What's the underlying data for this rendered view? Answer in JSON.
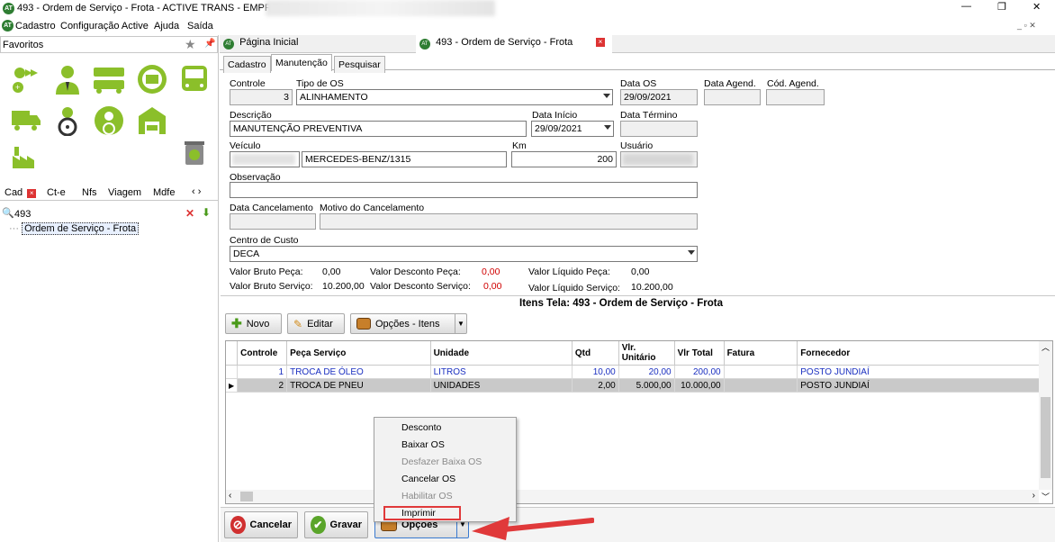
{
  "window": {
    "title": "493 - Ordem de Serviço - Frota - ACTIVE TRANS - EMPRESA: /",
    "controls": {
      "minimize": "—",
      "restore": "❐",
      "close": "✕"
    }
  },
  "menubar": {
    "items": [
      "Cadastro",
      "Configuração Active",
      "Ajuda",
      "Saída"
    ]
  },
  "sidebar": {
    "favorites_label": "Favoritos",
    "bottom_tabs": [
      "Cad",
      "Ct-e",
      "Nfs",
      "Viagem",
      "Mdfe"
    ],
    "search_value": "493",
    "tree_item": "Ordem de Serviço - Frota"
  },
  "doc_tabs": [
    "Página Inicial",
    "493 - Ordem de Serviço - Frota"
  ],
  "form_tabs": [
    "Cadastro",
    "Manutenção",
    "Pesquisar"
  ],
  "form": {
    "controle": {
      "label": "Controle",
      "value": "3"
    },
    "tipo_os": {
      "label": "Tipo de OS",
      "value": "ALINHAMENTO"
    },
    "data_os": {
      "label": "Data OS",
      "value": "29/09/2021"
    },
    "data_agend": {
      "label": "Data Agend.",
      "value": ""
    },
    "cod_agend": {
      "label": "Cód. Agend.",
      "value": ""
    },
    "descricao": {
      "label": "Descrição",
      "value": "MANUTENÇÃO PREVENTIVA"
    },
    "data_inicio": {
      "label": "Data Início",
      "value": "29/09/2021"
    },
    "data_termino": {
      "label": "Data Término",
      "value": ""
    },
    "veiculo": {
      "label": "Veículo",
      "plate": "",
      "model": "MERCEDES-BENZ/1315"
    },
    "km": {
      "label": "Km",
      "value": "200"
    },
    "usuario": {
      "label": "Usuário",
      "value": ""
    },
    "observacao": {
      "label": "Observação",
      "value": ""
    },
    "data_cancelamento": {
      "label": "Data Cancelamento",
      "value": ""
    },
    "motivo_cancelamento": {
      "label": "Motivo do Cancelamento",
      "value": ""
    },
    "centro_custo": {
      "label": "Centro de Custo",
      "value": "DECA"
    }
  },
  "totals": {
    "bruto_peca_label": "Valor Bruto Peça:",
    "bruto_peca": "0,00",
    "bruto_servico_label": "Valor Bruto Serviço:",
    "bruto_servico": "10.200,00",
    "desconto_peca_label": "Valor Desconto Peça:",
    "desconto_peca": "0,00",
    "desconto_servico_label": "Valor Desconto Serviço:",
    "desconto_servico": "0,00",
    "liquido_peca_label": "Valor Líquido Peça:",
    "liquido_peca": "0,00",
    "liquido_servico_label": "Valor Líquido Serviço:",
    "liquido_servico": "10.200,00"
  },
  "items_title": "Itens Tela:  493 - Ordem de Serviço - Frota",
  "item_buttons": {
    "novo": "Novo",
    "editar": "Editar",
    "opcoes": "Opções - Itens"
  },
  "grid": {
    "columns": [
      "Controle",
      "Peça Serviço",
      "Unidade",
      "Qtd",
      "Vlr. Unitário",
      "Vlr Total",
      "Fatura",
      "Fornecedor"
    ],
    "rows": [
      [
        "1",
        "TROCA DE ÓLEO",
        "LITROS",
        "10,00",
        "20,00",
        "200,00",
        "",
        "POSTO JUNDIAÍ"
      ],
      [
        "2",
        "TROCA DE PNEU",
        "UNIDADES",
        "2,00",
        "5.000,00",
        "10.000,00",
        "",
        "POSTO JUNDIAÍ"
      ]
    ]
  },
  "context_menu": {
    "items": [
      {
        "label": "Desconto",
        "enabled": true
      },
      {
        "label": "Baixar OS",
        "enabled": true
      },
      {
        "label": "Desfazer Baixa OS",
        "enabled": false
      },
      {
        "label": "Cancelar OS",
        "enabled": true
      },
      {
        "label": "Habilitar OS",
        "enabled": false
      },
      {
        "label": "Imprimir",
        "enabled": true
      }
    ]
  },
  "bottom_buttons": {
    "cancelar": "Cancelar",
    "gravar": "Gravar",
    "opcoes": "Opções"
  },
  "colors": {
    "accent_green": "#8bbf2a",
    "negative_red": "#d00000",
    "row_blue": "#1a2fc0",
    "arrow_red": "#e0393a"
  }
}
